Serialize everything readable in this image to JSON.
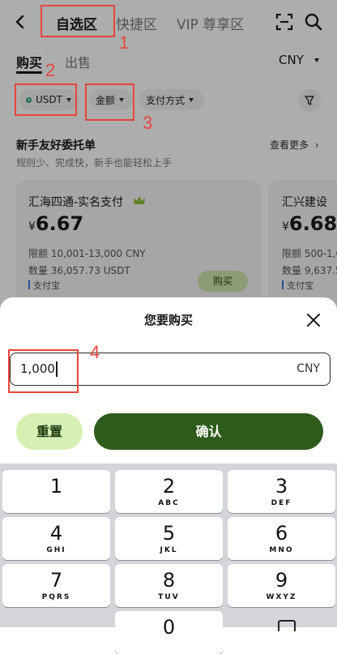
{
  "colors": {
    "accent_green": "#2e6e1a",
    "light_green": "#d6efb2",
    "annotation_red": "#e8453c"
  },
  "top_nav": {
    "tabs": [
      "自选区",
      "快捷区",
      "VIP 尊享区"
    ],
    "active_tab": "自选区",
    "icons": [
      "back-arrow-icon",
      "scan-icon",
      "search-icon"
    ]
  },
  "trade": {
    "tabs": [
      "购买",
      "出售"
    ],
    "active": "购买",
    "currency": "CNY"
  },
  "filters": {
    "asset": "USDT",
    "amount": "金额",
    "payment": "支付方式",
    "filter_icon": "funnel-icon"
  },
  "section": {
    "title": "新手友好委托单",
    "subtitle": "规则少、完成快，新手也能轻松上手",
    "more": "查看更多"
  },
  "cards": [
    {
      "name": "汇海四通-实名支付",
      "currency_symbol": "¥",
      "price": "6.67",
      "limit": "限额 10,001-13,000 CNY",
      "quantity": "数量 36,057.73 USDT",
      "payment": "支付宝",
      "button": "购买"
    },
    {
      "name": "汇兴建设",
      "currency_symbol": "¥",
      "price": "6.68",
      "limit": "限额 500-1,0",
      "quantity": "数量 9,637.5",
      "payment": "支付宝"
    }
  ],
  "sheet": {
    "title": "您要购买",
    "input_value": "1,000",
    "input_unit": "CNY",
    "reset": "重置",
    "confirm": "确认"
  },
  "keypad": [
    {
      "num": "1",
      "letters": ""
    },
    {
      "num": "2",
      "letters": "ABC"
    },
    {
      "num": "3",
      "letters": "DEF"
    },
    {
      "num": "4",
      "letters": "GHI"
    },
    {
      "num": "5",
      "letters": "JKL"
    },
    {
      "num": "6",
      "letters": "MNO"
    },
    {
      "num": "7",
      "letters": "PQRS"
    },
    {
      "num": "8",
      "letters": "TUV"
    },
    {
      "num": "9",
      "letters": "WXYZ"
    },
    {
      "num": "0",
      "letters": ""
    }
  ],
  "annotations": [
    "1",
    "2",
    "3",
    "4"
  ]
}
